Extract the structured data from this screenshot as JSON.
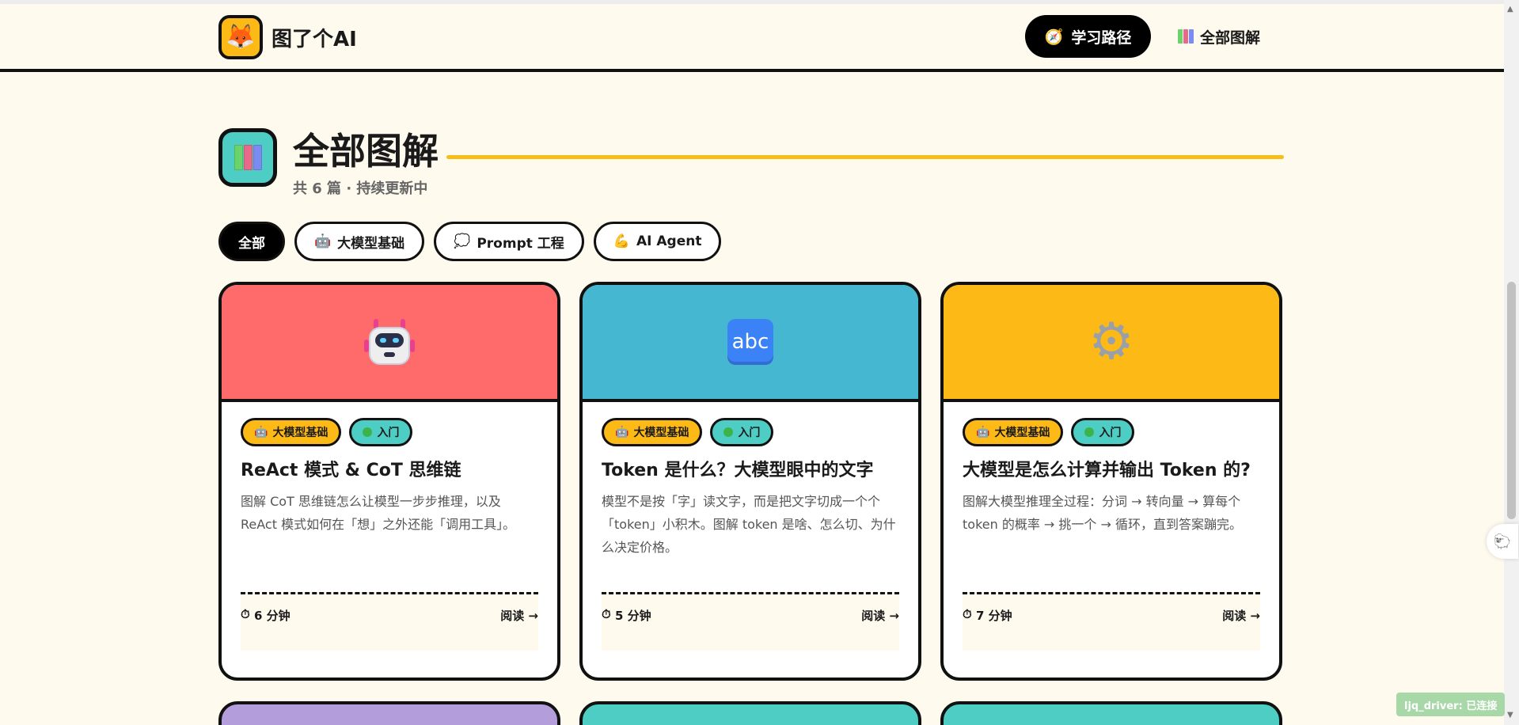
{
  "header": {
    "brand": "图了个AI",
    "nav": [
      {
        "label": "学习路径",
        "icon": "compass-icon"
      },
      {
        "label": "全部图解",
        "icon": "books-icon"
      }
    ]
  },
  "section": {
    "title": "全部图解",
    "subtitle": "共 6 篇 · 持续更新中"
  },
  "filters": [
    {
      "label": "全部",
      "icon": "",
      "active": true
    },
    {
      "label": "大模型基础",
      "icon": "robot-icon",
      "active": false
    },
    {
      "label": "Prompt 工程",
      "icon": "speech-bubble-icon",
      "active": false
    },
    {
      "label": "AI Agent",
      "icon": "flexed-arm-icon",
      "active": false
    }
  ],
  "cards": [
    {
      "banner_color": "#FF6B6B",
      "banner_icon": "robot-icon",
      "tags": [
        "大模型基础",
        "入门"
      ],
      "title": "ReAct 模式 & CoT 思维链",
      "desc": "图解 CoT 思维链怎么让模型一步步推理，以及 ReAct 模式如何在「想」之外还能「调用工具」。",
      "time": "6 分钟",
      "read": "阅读 →"
    },
    {
      "banner_color": "#45B7D1",
      "banner_icon": "abc-icon",
      "tags": [
        "大模型基础",
        "入门"
      ],
      "title": "Token 是什么？大模型眼中的文字",
      "desc": "模型不是按「字」读文字，而是把文字切成一个个「token」小积木。图解 token 是啥、怎么切、为什么决定价格。",
      "time": "5 分钟",
      "read": "阅读 →"
    },
    {
      "banner_color": "#FDB915",
      "banner_icon": "gear-icon",
      "tags": [
        "大模型基础",
        "入门"
      ],
      "title": "大模型是怎么计算并输出 Token 的?",
      "desc": "图解大模型推理全过程：分词 → 转向量 → 算每个 token 的概率 → 挑一个 → 循环，直到答案蹦完。",
      "time": "7 分钟",
      "read": "阅读 →"
    }
  ],
  "more_cards": [
    {
      "banner_color": "#B39DDB"
    },
    {
      "banner_color": "#4ECDC4"
    },
    {
      "banner_color": "#4ECDC4"
    }
  ],
  "status": "ljq_driver: 已连接",
  "colors": {
    "background": "#FFFAEE",
    "accent_yellow": "#FDB915",
    "accent_teal": "#4ECDC4"
  }
}
